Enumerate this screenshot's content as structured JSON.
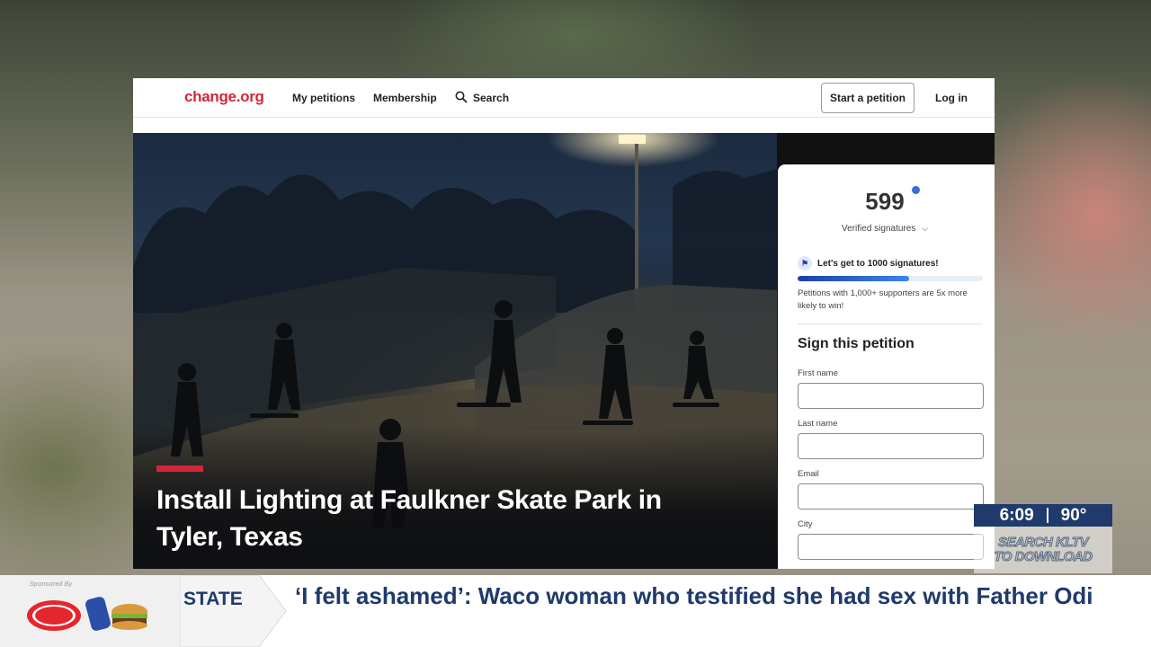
{
  "nav": {
    "logo": "change.org",
    "my_petitions": "My petitions",
    "membership": "Membership",
    "search": "Search",
    "start_petition": "Start a petition",
    "log_in": "Log in"
  },
  "petition": {
    "title": "Install Lighting at Faulkner Skate Park in Tyler, Texas",
    "signature_count": "599",
    "verified_label": "Verified signatures",
    "goal_text": "Let's get to 1000 signatures!",
    "progress_fraction": 0.6,
    "goal_note": "Petitions with 1,000+ supporters are 5x more likely to win!"
  },
  "sign_form": {
    "title": "Sign this petition",
    "fields": [
      {
        "label": "First name"
      },
      {
        "label": "Last name"
      },
      {
        "label": "Email"
      },
      {
        "label": "City"
      }
    ]
  },
  "broadcast": {
    "time": "6:09",
    "temperature": "90°",
    "promo_line1": "SEARCH KLTV",
    "promo_line2": "TO DOWNLOAD",
    "sponsor_label": "Sponsored By",
    "section": "STATE",
    "headline": "‘I felt ashamed’: Waco woman who testified she had sex with Father Odi"
  },
  "colors": {
    "brand_red": "#d3263a",
    "broadcast_blue": "#1f3a6b",
    "progress_blue": "#1d3fa8"
  }
}
